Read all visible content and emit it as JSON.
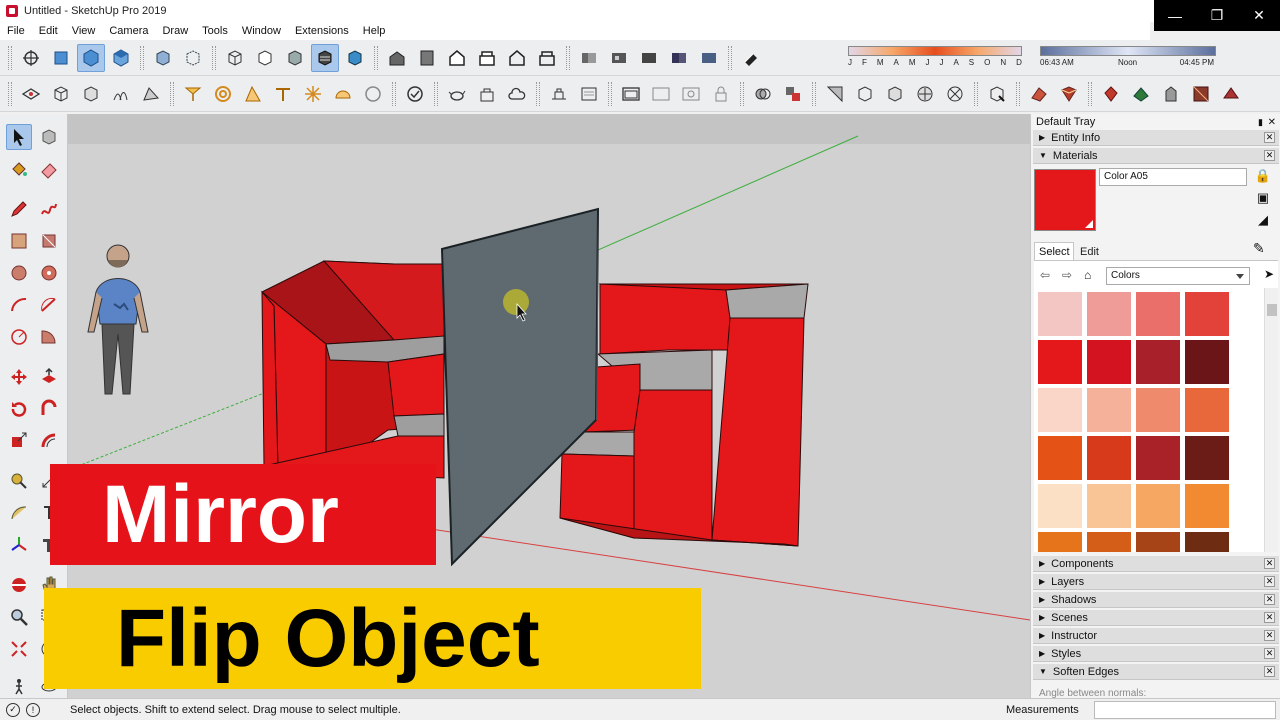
{
  "window": {
    "title": "Untitled - SketchUp Pro 2019",
    "controls": [
      "—",
      "❐",
      "✕"
    ]
  },
  "menu": [
    "File",
    "Edit",
    "View",
    "Camera",
    "Draw",
    "Tools",
    "Window",
    "Extensions",
    "Help"
  ],
  "shadow": {
    "months": [
      "J",
      "F",
      "M",
      "A",
      "M",
      "J",
      "J",
      "A",
      "S",
      "O",
      "N",
      "D"
    ],
    "time_start": "06:43 AM",
    "time_noon": "Noon",
    "time_end": "04:45 PM"
  },
  "captions": {
    "top": "Mirror",
    "bottom": "Flip Object"
  },
  "tray": {
    "title": "Default Tray",
    "pin": "▮",
    "close": "✕",
    "entity_info": "Entity Info",
    "materials": "Materials",
    "material_name": "Color A05",
    "material_color": "#e4171a",
    "tab_select": "Select",
    "tab_edit": "Edit",
    "collection": "Colors",
    "panels": [
      "Components",
      "Layers",
      "Shadows",
      "Scenes",
      "Instructor",
      "Styles",
      "Soften Edges"
    ],
    "angle_label": "Angle between normals:"
  },
  "swatches": [
    [
      "#f4c6c3",
      "#ef9b98",
      "#ea6f6b",
      "#e2423a"
    ],
    [
      "#e4171a",
      "#d41320",
      "#a8212a",
      "#6c1519"
    ],
    [
      "#f9d6c8",
      "#f5b19a",
      "#ef8b6c",
      "#e8683c"
    ],
    [
      "#e55216",
      "#d63a1b",
      "#a82227",
      "#6b1c17"
    ],
    [
      "#fbe0c6",
      "#f9c596",
      "#f6a863",
      "#f18a30"
    ],
    [
      "#e5741a",
      "#d45e17",
      "#a64317",
      "#6e2c13"
    ]
  ],
  "status": {
    "text": "Select objects. Shift to extend select. Drag mouse to select multiple.",
    "measurements_label": "Measurements"
  },
  "colors": {
    "model_red": "#e4171a",
    "mirror_plane": "#5e6a70",
    "caption_red": "#e6121a",
    "caption_yellow": "#f9cc00"
  }
}
